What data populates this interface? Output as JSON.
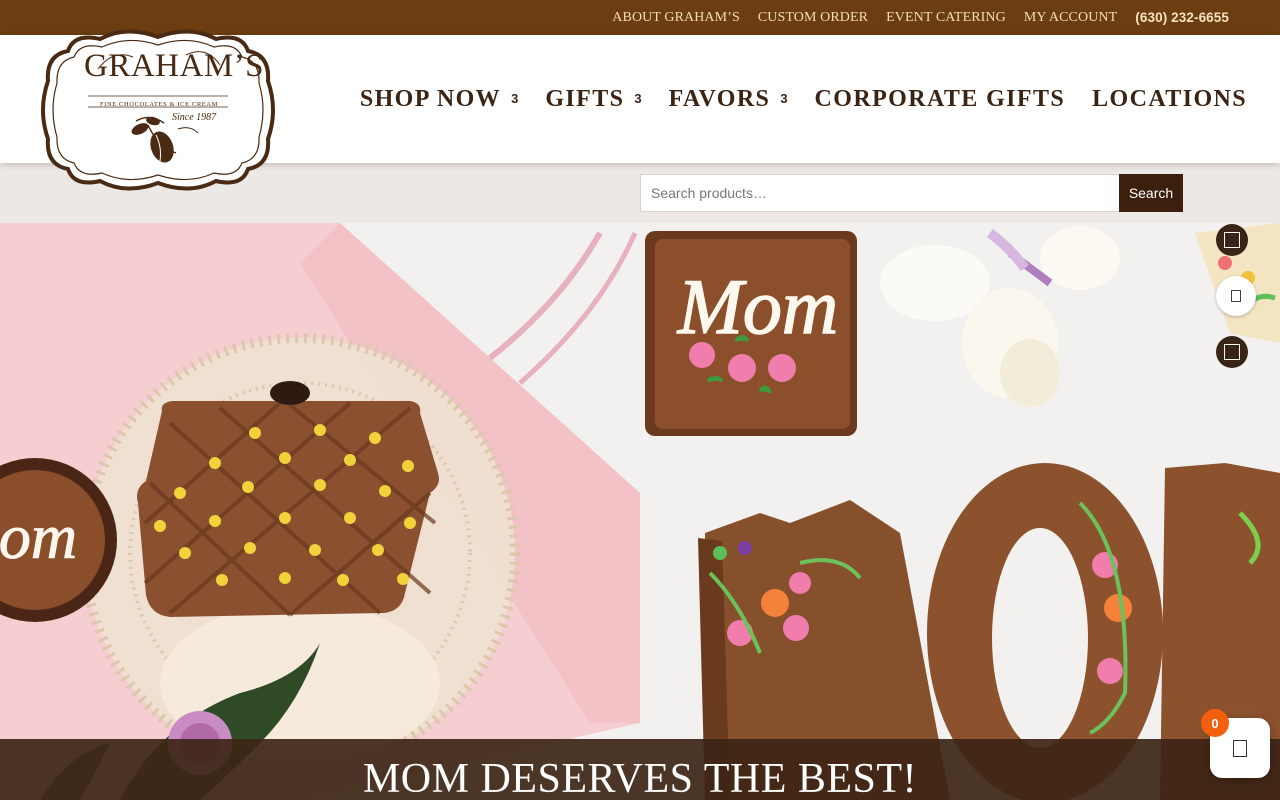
{
  "topbar": {
    "links": [
      {
        "label": "ABOUT GRAHAM’S"
      },
      {
        "label": "CUSTOM ORDER"
      },
      {
        "label": "EVENT CATERING"
      },
      {
        "label": "MY ACCOUNT"
      }
    ],
    "phone": "(630) 232-6655"
  },
  "logo": {
    "brand": "GRAHAM’S",
    "tagline": "FINE CHOCOLATES & ICE CREAM",
    "since": "Since 1987"
  },
  "nav": {
    "items": [
      {
        "label": "SHOP NOW",
        "caret": "3"
      },
      {
        "label": "GIFTS",
        "caret": "3"
      },
      {
        "label": "FAVORS",
        "caret": "3"
      },
      {
        "label": "CORPORATE GIFTS"
      },
      {
        "label": "LOCATIONS"
      }
    ]
  },
  "search": {
    "placeholder": "Search products…",
    "button_label": "Search"
  },
  "hero": {
    "caption": "MOM DESERVES THE BEST!",
    "mom_text": "Mom",
    "om_text": "om",
    "letters": "MOM"
  },
  "cart": {
    "count": "0"
  },
  "colors": {
    "topbar_bg": "#6b3d10",
    "topbar_text": "#f3dcb8",
    "nav_text": "#3b2414",
    "search_button_bg": "#3d1f0d",
    "badge": "#f2600d"
  }
}
